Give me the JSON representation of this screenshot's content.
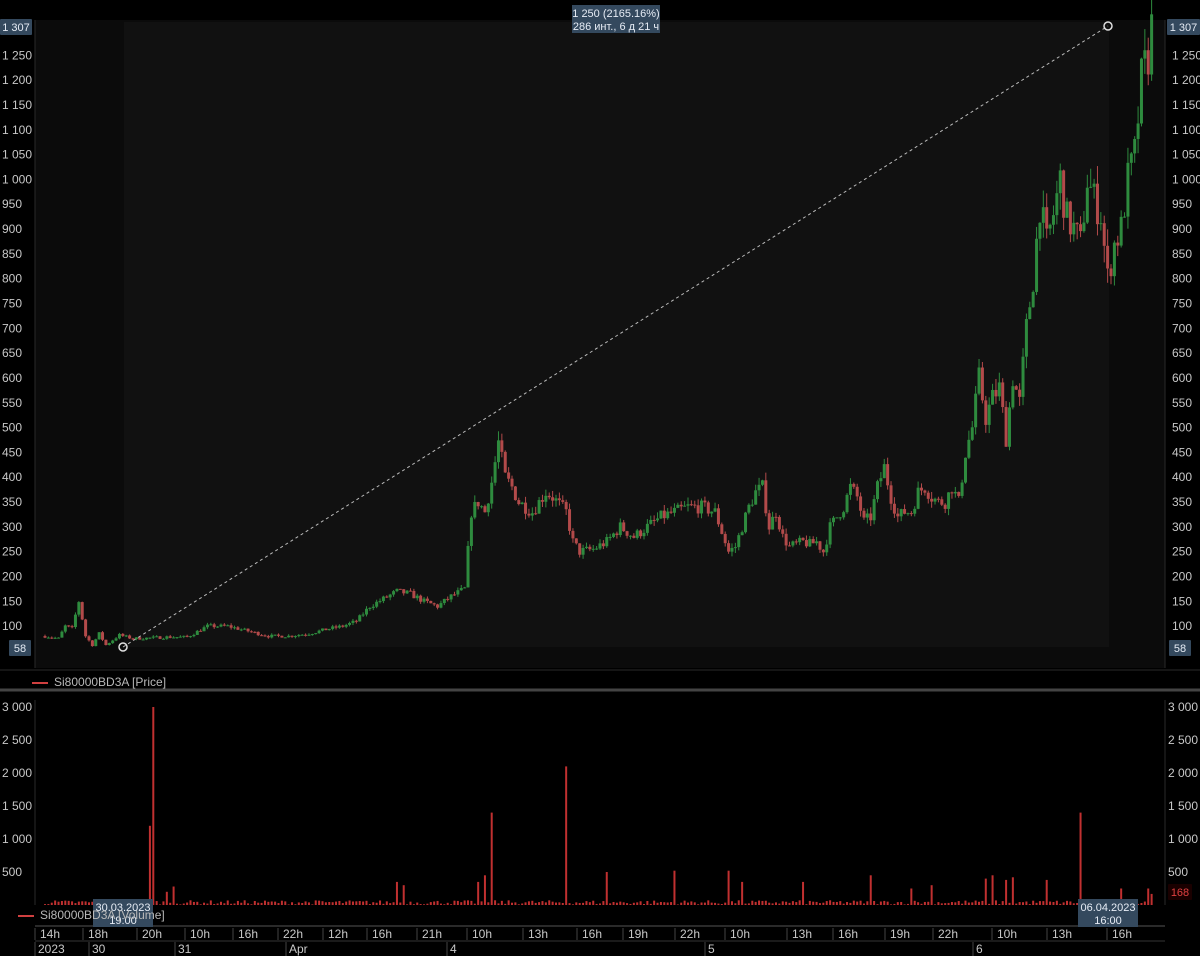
{
  "price_label_current": "1 307",
  "price_label_start": "58",
  "measure": {
    "line1": "1 250 (2165.16%)",
    "line2": "286 инт., 6 д 21 ч"
  },
  "legend_price": "Si80000BD3A [Price]",
  "legend_volume": "Si80000BD3A [Volume]",
  "volume_label_current": "168",
  "cursor_start": {
    "date": "30.03.2023",
    "time": "19:00"
  },
  "cursor_end": {
    "date": "06.04.2023",
    "time": "16:00"
  },
  "time_top_labels": [
    "14h",
    "18h",
    "20h",
    "10h",
    "16h",
    "22h",
    "12h",
    "16h",
    "21h",
    "10h",
    "13h",
    "16h",
    "19h",
    "22h",
    "10h",
    "13h",
    "16h",
    "19h",
    "22h",
    "10h",
    "13h",
    "16h"
  ],
  "time_bottom_labels": [
    "2023",
    "30",
    "31",
    "Apr",
    "4",
    "5",
    "6"
  ],
  "colors": {
    "up": "#2e8b3e",
    "down": "#b24a4a",
    "volume": "#c03030",
    "background": "#000000",
    "panel": "#0b0b0b"
  },
  "chart_data": [
    {
      "type": "candlestick",
      "series": [
        {
          "name": "Si80000BD3A [Price]"
        }
      ],
      "y_ticks": [
        100,
        150,
        200,
        250,
        300,
        350,
        400,
        450,
        500,
        550,
        600,
        650,
        700,
        750,
        800,
        850,
        900,
        950,
        1000,
        1050,
        1100,
        1150,
        1200,
        1250
      ],
      "ylim": [
        58,
        1307
      ],
      "close_path": [
        [
          0,
          80
        ],
        [
          4,
          75
        ],
        [
          6,
          100
        ],
        [
          8,
          95
        ],
        [
          10,
          150
        ],
        [
          12,
          80
        ],
        [
          14,
          62
        ],
        [
          16,
          85
        ],
        [
          18,
          62
        ],
        [
          22,
          82
        ],
        [
          26,
          75
        ],
        [
          30,
          76
        ],
        [
          36,
          78
        ],
        [
          42,
          78
        ],
        [
          48,
          100
        ],
        [
          54,
          100
        ],
        [
          60,
          90
        ],
        [
          66,
          80
        ],
        [
          72,
          80
        ],
        [
          78,
          85
        ],
        [
          84,
          95
        ],
        [
          88,
          100
        ],
        [
          92,
          110
        ],
        [
          96,
          140
        ],
        [
          100,
          155
        ],
        [
          104,
          170
        ],
        [
          108,
          165
        ],
        [
          112,
          150
        ],
        [
          116,
          140
        ],
        [
          120,
          160
        ],
        [
          124,
          175
        ],
        [
          126,
          330
        ],
        [
          128,
          350
        ],
        [
          130,
          330
        ],
        [
          132,
          390
        ],
        [
          134,
          470
        ],
        [
          136,
          400
        ],
        [
          138,
          380
        ],
        [
          140,
          350
        ],
        [
          144,
          330
        ],
        [
          148,
          370
        ],
        [
          150,
          360
        ],
        [
          154,
          330
        ],
        [
          156,
          270
        ],
        [
          158,
          250
        ],
        [
          162,
          255
        ],
        [
          166,
          270
        ],
        [
          170,
          300
        ],
        [
          174,
          280
        ],
        [
          178,
          300
        ],
        [
          182,
          320
        ],
        [
          186,
          330
        ],
        [
          190,
          340
        ],
        [
          194,
          340
        ],
        [
          198,
          330
        ],
        [
          200,
          290
        ],
        [
          202,
          250
        ],
        [
          204,
          260
        ],
        [
          206,
          300
        ],
        [
          208,
          340
        ],
        [
          210,
          370
        ],
        [
          212,
          380
        ],
        [
          214,
          300
        ],
        [
          216,
          330
        ],
        [
          218,
          280
        ],
        [
          220,
          260
        ],
        [
          224,
          270
        ],
        [
          226,
          265
        ],
        [
          228,
          270
        ],
        [
          230,
          250
        ],
        [
          232,
          300
        ],
        [
          234,
          320
        ],
        [
          236,
          340
        ],
        [
          238,
          380
        ],
        [
          240,
          360
        ],
        [
          242,
          310
        ],
        [
          244,
          320
        ],
        [
          246,
          380
        ],
        [
          248,
          420
        ],
        [
          250,
          360
        ],
        [
          252,
          320
        ],
        [
          254,
          330
        ],
        [
          256,
          330
        ],
        [
          258,
          370
        ],
        [
          260,
          380
        ],
        [
          262,
          360
        ],
        [
          264,
          350
        ],
        [
          266,
          350
        ],
        [
          268,
          380
        ],
        [
          270,
          350
        ],
        [
          272,
          450
        ],
        [
          274,
          500
        ],
        [
          276,
          600
        ],
        [
          278,
          520
        ],
        [
          280,
          560
        ],
        [
          282,
          580
        ],
        [
          284,
          480
        ],
        [
          286,
          600
        ],
        [
          288,
          550
        ],
        [
          290,
          700
        ],
        [
          292,
          800
        ],
        [
          294,
          950
        ],
        [
          296,
          870
        ],
        [
          298,
          930
        ],
        [
          300,
          1000
        ],
        [
          302,
          920
        ],
        [
          304,
          900
        ],
        [
          306,
          870
        ],
        [
          308,
          1000
        ],
        [
          310,
          960
        ],
        [
          312,
          930
        ],
        [
          314,
          800
        ],
        [
          316,
          870
        ],
        [
          318,
          900
        ],
        [
          320,
          1000
        ],
        [
          322,
          1050
        ],
        [
          324,
          1200
        ],
        [
          326,
          1250
        ],
        [
          327,
          1307
        ]
      ],
      "notable": {
        "start_low": 58,
        "first_spike_high": 490,
        "end_close": 1307
      }
    },
    {
      "type": "bar",
      "series": [
        {
          "name": "Si80000BD3A [Volume]"
        }
      ],
      "y_ticks": [
        500,
        1000,
        1500,
        2000,
        2500,
        3000
      ],
      "ylim": [
        0,
        3050
      ],
      "spikes": [
        [
          31,
          1200
        ],
        [
          32,
          3000
        ],
        [
          36,
          200
        ],
        [
          38,
          280
        ],
        [
          104,
          350
        ],
        [
          106,
          300
        ],
        [
          128,
          350
        ],
        [
          130,
          450
        ],
        [
          132,
          1400
        ],
        [
          154,
          2100
        ],
        [
          166,
          500
        ],
        [
          186,
          520
        ],
        [
          202,
          520
        ],
        [
          206,
          350
        ],
        [
          224,
          350
        ],
        [
          244,
          450
        ],
        [
          256,
          250
        ],
        [
          262,
          300
        ],
        [
          278,
          400
        ],
        [
          280,
          450
        ],
        [
          284,
          380
        ],
        [
          286,
          420
        ],
        [
          296,
          380
        ],
        [
          306,
          1400
        ],
        [
          318,
          250
        ],
        [
          326,
          250
        ],
        [
          327,
          168
        ]
      ],
      "base_level": 40
    }
  ]
}
